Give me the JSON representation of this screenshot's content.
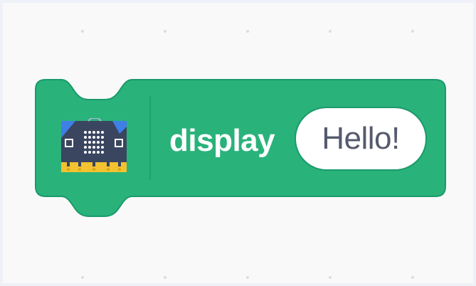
{
  "workspace": {
    "background": "#f9f9fa"
  },
  "block": {
    "category": "display",
    "color": "#2ab27b",
    "border_color": "#1a9a6a",
    "icon": "microbit-icon",
    "label": "display",
    "input": {
      "value": "Hello!"
    }
  }
}
